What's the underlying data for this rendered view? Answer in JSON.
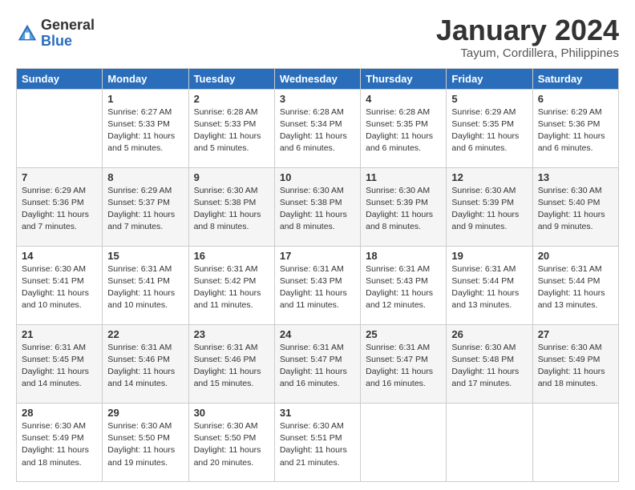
{
  "logo": {
    "general": "General",
    "blue": "Blue"
  },
  "title": {
    "month": "January 2024",
    "location": "Tayum, Cordillera, Philippines"
  },
  "headers": [
    "Sunday",
    "Monday",
    "Tuesday",
    "Wednesday",
    "Thursday",
    "Friday",
    "Saturday"
  ],
  "weeks": [
    [
      {
        "day": "",
        "info": ""
      },
      {
        "day": "1",
        "info": "Sunrise: 6:27 AM\nSunset: 5:33 PM\nDaylight: 11 hours\nand 5 minutes."
      },
      {
        "day": "2",
        "info": "Sunrise: 6:28 AM\nSunset: 5:33 PM\nDaylight: 11 hours\nand 5 minutes."
      },
      {
        "day": "3",
        "info": "Sunrise: 6:28 AM\nSunset: 5:34 PM\nDaylight: 11 hours\nand 6 minutes."
      },
      {
        "day": "4",
        "info": "Sunrise: 6:28 AM\nSunset: 5:35 PM\nDaylight: 11 hours\nand 6 minutes."
      },
      {
        "day": "5",
        "info": "Sunrise: 6:29 AM\nSunset: 5:35 PM\nDaylight: 11 hours\nand 6 minutes."
      },
      {
        "day": "6",
        "info": "Sunrise: 6:29 AM\nSunset: 5:36 PM\nDaylight: 11 hours\nand 6 minutes."
      }
    ],
    [
      {
        "day": "7",
        "info": "Sunrise: 6:29 AM\nSunset: 5:36 PM\nDaylight: 11 hours\nand 7 minutes."
      },
      {
        "day": "8",
        "info": "Sunrise: 6:29 AM\nSunset: 5:37 PM\nDaylight: 11 hours\nand 7 minutes."
      },
      {
        "day": "9",
        "info": "Sunrise: 6:30 AM\nSunset: 5:38 PM\nDaylight: 11 hours\nand 8 minutes."
      },
      {
        "day": "10",
        "info": "Sunrise: 6:30 AM\nSunset: 5:38 PM\nDaylight: 11 hours\nand 8 minutes."
      },
      {
        "day": "11",
        "info": "Sunrise: 6:30 AM\nSunset: 5:39 PM\nDaylight: 11 hours\nand 8 minutes."
      },
      {
        "day": "12",
        "info": "Sunrise: 6:30 AM\nSunset: 5:39 PM\nDaylight: 11 hours\nand 9 minutes."
      },
      {
        "day": "13",
        "info": "Sunrise: 6:30 AM\nSunset: 5:40 PM\nDaylight: 11 hours\nand 9 minutes."
      }
    ],
    [
      {
        "day": "14",
        "info": "Sunrise: 6:30 AM\nSunset: 5:41 PM\nDaylight: 11 hours\nand 10 minutes."
      },
      {
        "day": "15",
        "info": "Sunrise: 6:31 AM\nSunset: 5:41 PM\nDaylight: 11 hours\nand 10 minutes."
      },
      {
        "day": "16",
        "info": "Sunrise: 6:31 AM\nSunset: 5:42 PM\nDaylight: 11 hours\nand 11 minutes."
      },
      {
        "day": "17",
        "info": "Sunrise: 6:31 AM\nSunset: 5:43 PM\nDaylight: 11 hours\nand 11 minutes."
      },
      {
        "day": "18",
        "info": "Sunrise: 6:31 AM\nSunset: 5:43 PM\nDaylight: 11 hours\nand 12 minutes."
      },
      {
        "day": "19",
        "info": "Sunrise: 6:31 AM\nSunset: 5:44 PM\nDaylight: 11 hours\nand 13 minutes."
      },
      {
        "day": "20",
        "info": "Sunrise: 6:31 AM\nSunset: 5:44 PM\nDaylight: 11 hours\nand 13 minutes."
      }
    ],
    [
      {
        "day": "21",
        "info": "Sunrise: 6:31 AM\nSunset: 5:45 PM\nDaylight: 11 hours\nand 14 minutes."
      },
      {
        "day": "22",
        "info": "Sunrise: 6:31 AM\nSunset: 5:46 PM\nDaylight: 11 hours\nand 14 minutes."
      },
      {
        "day": "23",
        "info": "Sunrise: 6:31 AM\nSunset: 5:46 PM\nDaylight: 11 hours\nand 15 minutes."
      },
      {
        "day": "24",
        "info": "Sunrise: 6:31 AM\nSunset: 5:47 PM\nDaylight: 11 hours\nand 16 minutes."
      },
      {
        "day": "25",
        "info": "Sunrise: 6:31 AM\nSunset: 5:47 PM\nDaylight: 11 hours\nand 16 minutes."
      },
      {
        "day": "26",
        "info": "Sunrise: 6:30 AM\nSunset: 5:48 PM\nDaylight: 11 hours\nand 17 minutes."
      },
      {
        "day": "27",
        "info": "Sunrise: 6:30 AM\nSunset: 5:49 PM\nDaylight: 11 hours\nand 18 minutes."
      }
    ],
    [
      {
        "day": "28",
        "info": "Sunrise: 6:30 AM\nSunset: 5:49 PM\nDaylight: 11 hours\nand 18 minutes."
      },
      {
        "day": "29",
        "info": "Sunrise: 6:30 AM\nSunset: 5:50 PM\nDaylight: 11 hours\nand 19 minutes."
      },
      {
        "day": "30",
        "info": "Sunrise: 6:30 AM\nSunset: 5:50 PM\nDaylight: 11 hours\nand 20 minutes."
      },
      {
        "day": "31",
        "info": "Sunrise: 6:30 AM\nSunset: 5:51 PM\nDaylight: 11 hours\nand 21 minutes."
      },
      {
        "day": "",
        "info": ""
      },
      {
        "day": "",
        "info": ""
      },
      {
        "day": "",
        "info": ""
      }
    ]
  ]
}
